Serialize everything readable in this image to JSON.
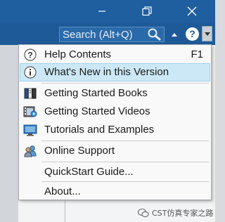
{
  "search": {
    "placeholder": "Search (Alt+Q)"
  },
  "menu": {
    "items": [
      {
        "label": "Help Contents",
        "shortcut": "F1",
        "icon": "help-circle-icon"
      },
      {
        "label": "What's New in this Version",
        "shortcut": "",
        "icon": "info-icon",
        "highlighted": true
      },
      {
        "label": "Getting Started Books",
        "shortcut": "",
        "icon": "books-icon"
      },
      {
        "label": "Getting Started Videos",
        "shortcut": "",
        "icon": "video-icon"
      },
      {
        "label": "Tutorials and Examples",
        "shortcut": "",
        "icon": "tutorial-monitor-icon"
      },
      {
        "label": "Online Support",
        "shortcut": "",
        "icon": "support-people-icon"
      },
      {
        "label": "QuickStart Guide...",
        "shortcut": "",
        "icon": ""
      },
      {
        "label": "About...",
        "shortcut": "",
        "icon": ""
      }
    ]
  },
  "watermark": {
    "text": "CST仿真专家之路"
  },
  "colors": {
    "titlebar": "#1f5fa0",
    "menu_highlight": "#cce8f6",
    "menu_highlight_border": "#9fd2ee"
  }
}
